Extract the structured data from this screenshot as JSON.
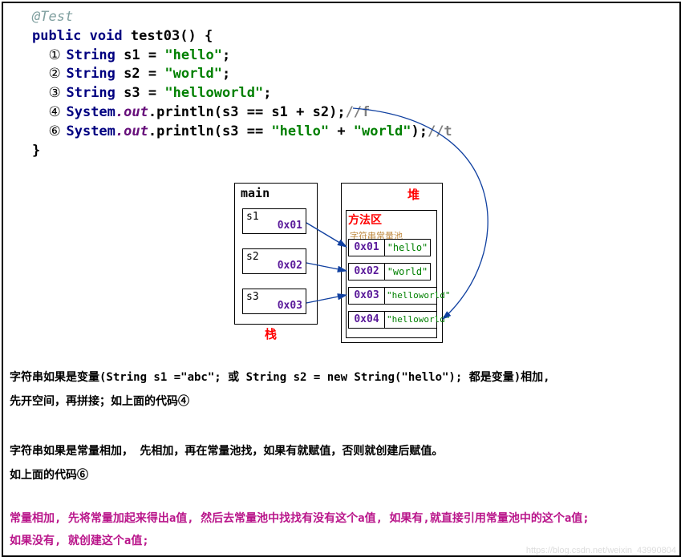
{
  "code": {
    "annotation": "@Test",
    "method_decl": {
      "keywords": "public void",
      "name": "test03",
      "paren": "()",
      "brace_open": " {",
      "brace_close": "}"
    },
    "lines": [
      {
        "num": "①",
        "type": "String",
        "var": "s1",
        "assign": " = ",
        "lit": "\"hello\"",
        "term": ";"
      },
      {
        "num": "②",
        "type": "String",
        "var": "s2",
        "assign": " = ",
        "lit": "\"world\"",
        "term": ";"
      },
      {
        "num": "③",
        "type": "String",
        "var": "s3",
        "assign": " = ",
        "lit": "\"helloworld\"",
        "term": ";"
      }
    ],
    "println4": {
      "num": "④",
      "cls": "System",
      "field": ".out",
      "method": ".println",
      "open": "(",
      "expr_a": "s3 == s1 + s2",
      "close": ")",
      "term": ";",
      "comment": "//f"
    },
    "println6": {
      "num": "⑥",
      "cls": "System",
      "field": ".out",
      "method": ".println",
      "open": "(",
      "pre": "s3 == ",
      "lit1": "\"hello\"",
      "plus": " + ",
      "lit2": "\"world\"",
      "close": ")",
      "term": ";",
      "comment": "//t"
    }
  },
  "diagram": {
    "stack": {
      "title": "main",
      "label": "栈",
      "vars": [
        {
          "name": "s1",
          "addr": "0x01"
        },
        {
          "name": "s2",
          "addr": "0x02"
        },
        {
          "name": "s3",
          "addr": "0x03"
        }
      ]
    },
    "heap": {
      "title": "堆",
      "method_area": "方法区",
      "pool_title": "字符串常量池",
      "pool": [
        {
          "addr": "0x01",
          "value": "\"hello\""
        },
        {
          "addr": "0x02",
          "value": "\"world\""
        },
        {
          "addr": "0x03",
          "value": "\"helloworld\""
        },
        {
          "addr": "0x04",
          "value": "\"helloworld\""
        }
      ]
    }
  },
  "explain": {
    "p1": "字符串如果是变量(String s1 =\"abc\"; 或 String s2 = new String(\"hello\"); 都是变量)相加,",
    "p2": "先开空间，再拼接；如上面的代码④",
    "p3": "字符串如果是常量相加， 先相加，再在常量池找，如果有就赋值，否则就创建后赋值。",
    "p4": "如上面的代码⑥",
    "p5": "常量相加, 先将常量加起来得出a值, 然后去常量池中找找有没有这个a值, 如果有,就直接引用常量池中的这个a值;",
    "p6": "如果没有, 就创建这个a值;"
  },
  "watermark": "https://blog.csdn.net/weixin_43990804"
}
